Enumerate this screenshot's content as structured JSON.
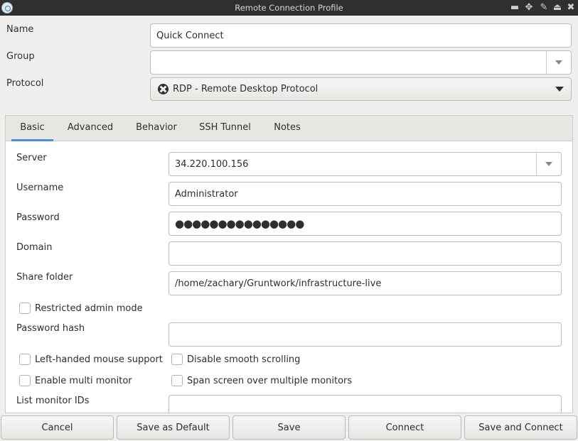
{
  "window": {
    "title": "Remote Connection Profile"
  },
  "header": {
    "name_label": "Name",
    "name_value": "Quick Connect",
    "group_label": "Group",
    "group_value": "",
    "protocol_label": "Protocol",
    "protocol_value": "RDP - Remote Desktop Protocol"
  },
  "tabs": [
    {
      "label": "Basic",
      "active": true
    },
    {
      "label": "Advanced"
    },
    {
      "label": "Behavior"
    },
    {
      "label": "SSH Tunnel"
    },
    {
      "label": "Notes"
    }
  ],
  "basic": {
    "server_label": "Server",
    "server_value": "34.220.100.156",
    "username_label": "Username",
    "username_value": "Administrator",
    "password_label": "Password",
    "password_value": "●●●●●●●●●●●●●●●",
    "domain_label": "Domain",
    "domain_value": "",
    "share_label": "Share folder",
    "share_value": "/home/zachary/Gruntwork/infrastructure-live",
    "restricted_admin_label": "Restricted admin mode",
    "password_hash_label": "Password hash",
    "password_hash_value": "",
    "left_handed_label": "Left-handed mouse support",
    "disable_smooth_label": "Disable smooth scrolling",
    "multi_monitor_label": "Enable multi monitor",
    "span_screen_label": "Span screen over multiple monitors",
    "list_monitor_label": "List monitor IDs",
    "list_monitor_value": ""
  },
  "buttons": {
    "cancel": "Cancel",
    "save_default": "Save as Default",
    "save": "Save",
    "connect": "Connect",
    "save_connect": "Save and Connect"
  }
}
